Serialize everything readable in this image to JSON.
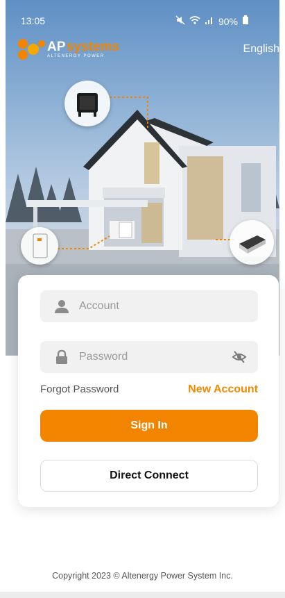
{
  "status_bar": {
    "time": "13:05",
    "battery": "90%"
  },
  "header": {
    "brand_ap": "AP",
    "brand_systems": "systems",
    "brand_tagline": "ALTENERGY POWER",
    "language": "English"
  },
  "login": {
    "account_placeholder": "Account",
    "password_placeholder": "Password",
    "forgot_label": "Forgot Password",
    "new_account_label": "New Account",
    "sign_in_label": "Sign In",
    "direct_connect_label": "Direct Connect"
  },
  "footer": {
    "copyright": "Copyright 2023 © Altenergy Power System Inc."
  },
  "colors": {
    "accent": "#f28400",
    "accent_text": "#f08a00"
  },
  "icons": [
    "person-icon",
    "lock-icon",
    "eye-off-icon",
    "mute-icon",
    "wifi-icon",
    "signal-icon",
    "battery-icon"
  ]
}
